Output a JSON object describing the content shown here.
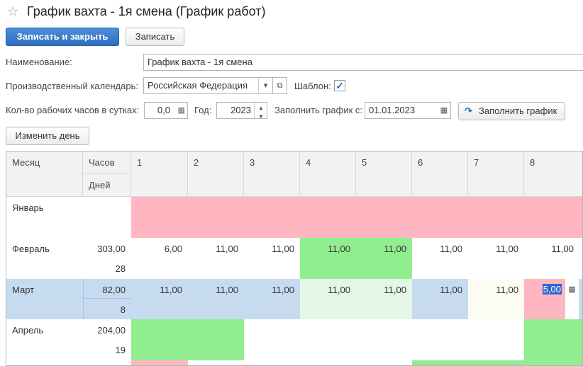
{
  "window": {
    "title": "График вахта - 1я смена (График работ)"
  },
  "toolbar": {
    "save_close_label": "Записать и закрыть",
    "save_label": "Записать"
  },
  "form": {
    "name_label": "Наименование:",
    "name_value": "График вахта - 1я смена",
    "calendar_label": "Производственный календарь:",
    "calendar_value": "Российская Федерация",
    "template_label": "Шаблон:",
    "template_checked": true,
    "hours_label": "Кол-во рабочих часов в сутках:",
    "hours_value": "0,0",
    "year_label": "Год:",
    "year_value": "2023",
    "fill_from_label": "Заполнить график с:",
    "fill_from_value": "01.01.2023",
    "fill_button": "Заполнить график",
    "change_day_button": "Изменить день"
  },
  "table": {
    "headers": {
      "month": "Месяц",
      "hours": "Часов",
      "days": "Дней"
    },
    "day_columns": [
      "1",
      "2",
      "3",
      "4",
      "5",
      "6",
      "7",
      "8"
    ],
    "rows": [
      {
        "month": "Январь",
        "hours": "",
        "days": "",
        "values": [
          "",
          "",
          "",
          "",
          "",
          "",
          "",
          ""
        ]
      },
      {
        "month": "Февраль",
        "hours": "303,00",
        "days": "28",
        "values": [
          "6,00",
          "11,00",
          "11,00",
          "11,00",
          "11,00",
          "11,00",
          "11,00",
          "11,00"
        ]
      },
      {
        "month": "Март",
        "hours": "82,00",
        "days": "8",
        "values": [
          "11,00",
          "11,00",
          "11,00",
          "11,00",
          "11,00",
          "11,00",
          "11,00",
          "5,00"
        ]
      },
      {
        "month": "Апрель",
        "hours": "204,00",
        "days": "19",
        "values": [
          "",
          "",
          "",
          "",
          "",
          "",
          "",
          ""
        ]
      }
    ]
  },
  "colors": {
    "weekend": "#ffb6c1",
    "holiday": "#90ee90",
    "selected_row": "#c6dbf0",
    "primary_button": "#2d6ec0"
  },
  "icons": [
    "star-icon",
    "dropdown-arrow-icon",
    "open-icon",
    "checkbox-check-icon",
    "calendar-icon",
    "spinner-up-icon",
    "spinner-down-icon",
    "refresh-arrow-icon"
  ]
}
